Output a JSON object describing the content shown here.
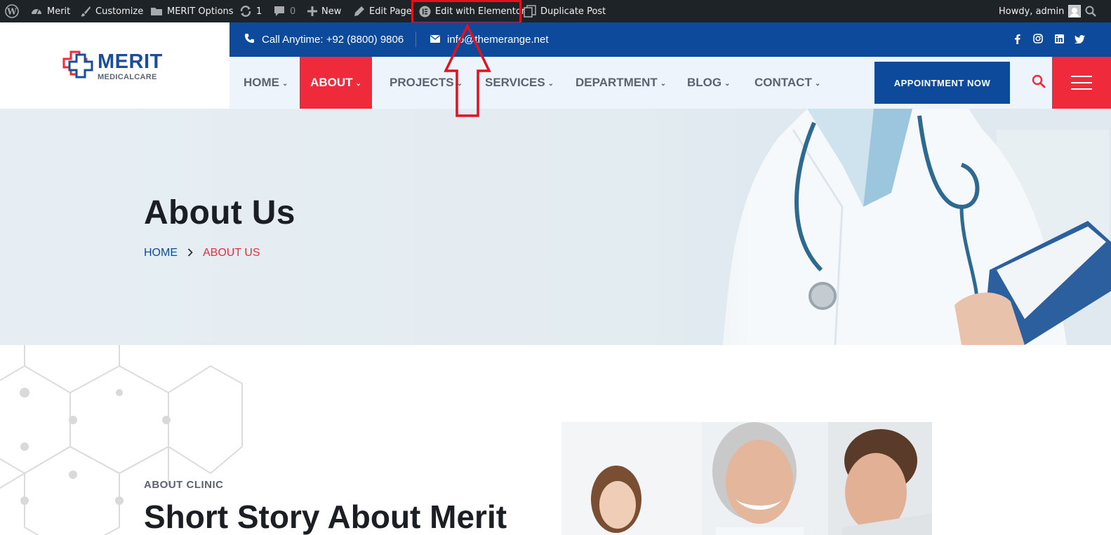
{
  "admin_bar": {
    "site_name": "Merit",
    "customize": "Customize",
    "options": "MERIT Options",
    "updates_count": "1",
    "comments_count": "0",
    "new": "New",
    "edit_page": "Edit Page",
    "edit_elementor": "Edit with Elementor",
    "duplicate_post": "Duplicate Post",
    "greeting": "Howdy, admin"
  },
  "logo": {
    "name": "MERIT",
    "subtitle": "MEDICALCARE"
  },
  "topbar": {
    "phone": "Call Anytime: +92 (8800) 9806",
    "email": "info@themerange.net",
    "socials": [
      "facebook",
      "instagram",
      "linkedin",
      "twitter"
    ]
  },
  "nav": {
    "items": [
      {
        "label": "HOME",
        "active": false
      },
      {
        "label": "ABOUT",
        "active": true
      },
      {
        "label": "PROJECTS",
        "active": false
      },
      {
        "label": "SERVICES",
        "active": false
      },
      {
        "label": "DEPARTMENT",
        "active": false
      },
      {
        "label": "BLOG",
        "active": false
      },
      {
        "label": "CONTACT",
        "active": false
      }
    ],
    "cta": "APPOINTMENT NOW"
  },
  "hero": {
    "title": "About Us",
    "breadcrumb_home": "HOME",
    "breadcrumb_current": "ABOUT US"
  },
  "section": {
    "eyebrow": "ABOUT CLINIC",
    "title": "Short Story About Merit"
  },
  "colors": {
    "primary_blue": "#0e4a9c",
    "accent_red": "#ee2a3b",
    "admin_bar": "#1d2327"
  }
}
